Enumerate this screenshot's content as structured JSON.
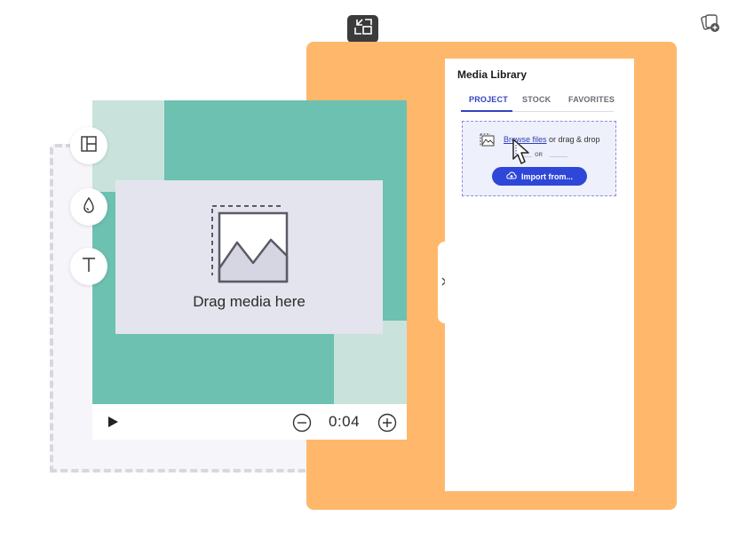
{
  "media_library": {
    "title": "Media Library",
    "tabs": [
      {
        "label": "PROJECT",
        "active": true
      },
      {
        "label": "STOCK",
        "active": false
      },
      {
        "label": "FAVORITES",
        "active": false
      }
    ],
    "dropzone": {
      "browse_link": "Browse files",
      "browse_suffix": " or drag & drop",
      "or_label": "OR",
      "import_button": "Import from..."
    }
  },
  "canvas": {
    "drop_label": "Drag media here"
  },
  "playbar": {
    "time": "0:04"
  },
  "colors": {
    "orange_panel": "#ffb86b",
    "canvas_teal": "#6cc1b0",
    "accent_blue": "#2e47d8"
  },
  "icons": [
    "minimize-icon",
    "add-to-library-icon",
    "layout-icon",
    "color-drop-icon",
    "text-icon",
    "chevron-right-icon",
    "image-icon",
    "cloud-upload-icon",
    "pointer-cursor-icon",
    "play-icon",
    "zoom-out-icon",
    "zoom-in-icon"
  ]
}
